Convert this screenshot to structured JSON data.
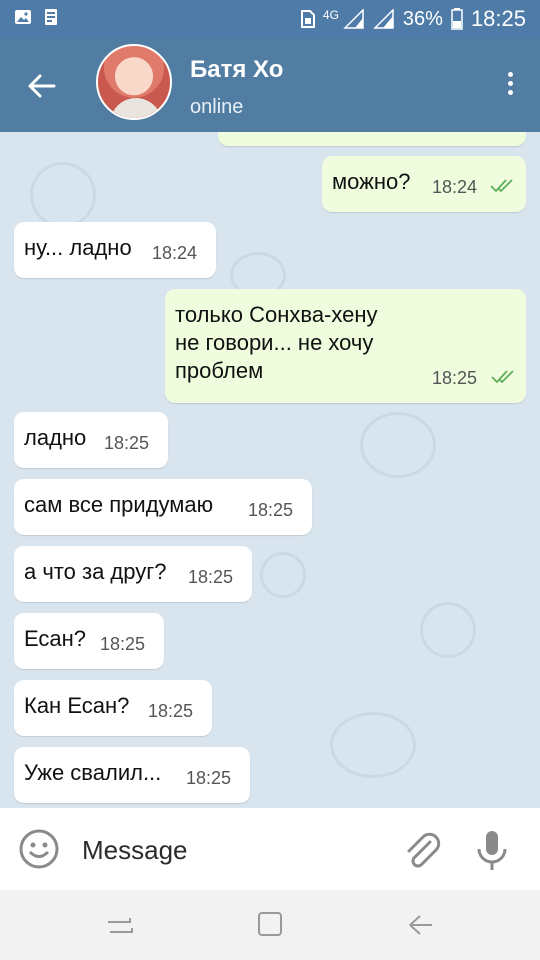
{
  "status_bar": {
    "network": "4G",
    "battery": "36%",
    "time": "18:25"
  },
  "header": {
    "name": "Батя Хо",
    "status": "online"
  },
  "messages": [
    {
      "dir": "out",
      "text": "можно?",
      "time": "18:24"
    },
    {
      "dir": "in",
      "text": "ну... ладно",
      "time": "18:24"
    },
    {
      "dir": "out",
      "text": "только Сонхва-хену\nне говори... не хочу\nпроблем",
      "time": "18:25"
    },
    {
      "dir": "in",
      "text": "ладно",
      "time": "18:25"
    },
    {
      "dir": "in",
      "text": "сам все придумаю",
      "time": "18:25"
    },
    {
      "dir": "in",
      "text": "а что за друг?",
      "time": "18:25"
    },
    {
      "dir": "in",
      "text": "Есан?",
      "time": "18:25"
    },
    {
      "dir": "in",
      "text": "Кан Есан?",
      "time": "18:25"
    },
    {
      "dir": "in",
      "text": "Уже свалил...",
      "time": "18:25"
    }
  ],
  "input": {
    "placeholder": "Message"
  },
  "icons": {
    "back": "arrow-left-icon",
    "menu": "more-vertical-icon",
    "emoji": "emoji-icon",
    "attach": "paperclip-icon",
    "mic": "microphone-icon"
  },
  "colors": {
    "header": "#517da2",
    "status_bar": "#4e7ba7",
    "outgoing_bubble": "#effdde",
    "incoming_bubble": "#ffffff",
    "read_check": "#5fae5c"
  }
}
